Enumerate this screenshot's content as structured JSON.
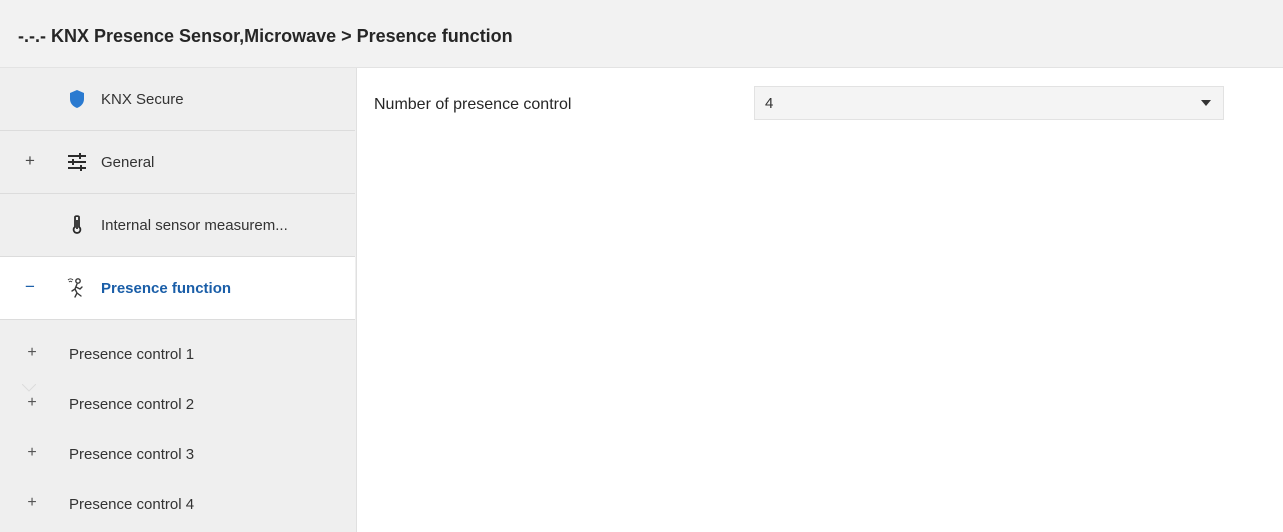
{
  "header": {
    "title": "-.-.- KNX Presence Sensor,Microwave > Presence function"
  },
  "sidebar": {
    "items": [
      {
        "label": "KNX Secure",
        "expander": "",
        "icon": "shield-icon"
      },
      {
        "label": "General",
        "expander": "+",
        "icon": "sliders-icon"
      },
      {
        "label": "Internal sensor measurem...",
        "expander": "",
        "icon": "thermometer-icon"
      },
      {
        "label": "Presence function",
        "expander": "−",
        "icon": "person-walking-icon",
        "active": true
      }
    ],
    "sub_items": [
      {
        "label": "Presence control 1",
        "expander": "+"
      },
      {
        "label": "Presence control 2",
        "expander": "+"
      },
      {
        "label": "Presence control 3",
        "expander": "+"
      },
      {
        "label": "Presence control 4",
        "expander": "+"
      }
    ]
  },
  "main": {
    "param": {
      "label": "Number of presence control",
      "value": "4"
    }
  },
  "colors": {
    "accent": "#1a5ea8",
    "shield": "#2a7ad0",
    "header_bg": "#f2f2f2",
    "sidebar_bg": "#efefef"
  }
}
